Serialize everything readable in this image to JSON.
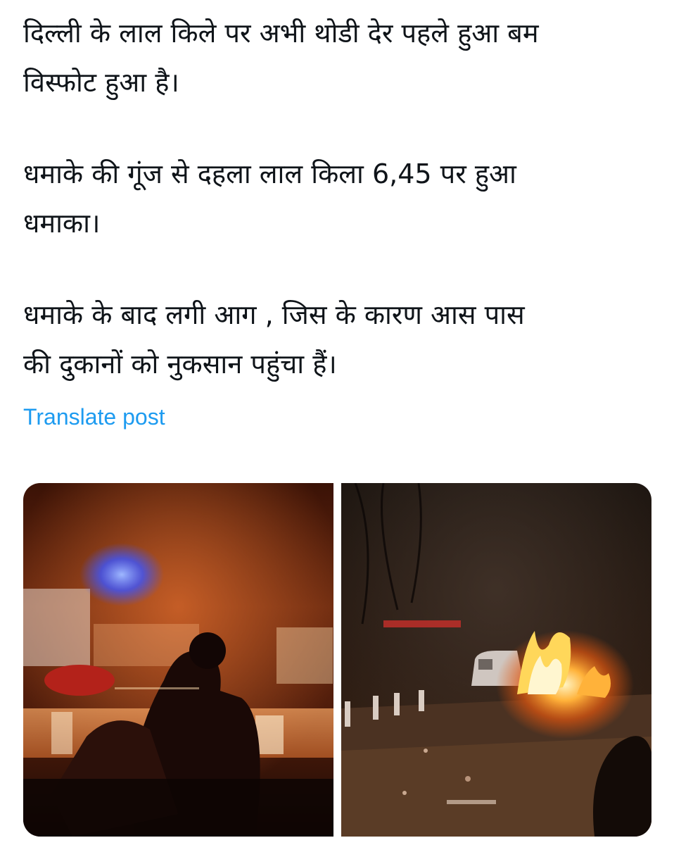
{
  "post": {
    "paragraphs": [
      {
        "lines": [
          "दिल्ली के लाल किले पर अभी थोडी देर पहले हुआ बम",
          "विस्फोट हुआ है।"
        ]
      },
      {
        "lines": [
          "धमाके की गूंज से दहला लाल किला 6,45 पर हुआ",
          "धमाका।"
        ]
      },
      {
        "lines": [
          "धमाके के बाद लगी आग , जिस के कारण आस पास",
          "की दुकानों को नुकसान पहुंचा हैं।"
        ]
      }
    ],
    "translate_label": "Translate post"
  },
  "media": [
    {
      "type": "photo",
      "subject": "night-crowd-fire-glow"
    },
    {
      "type": "photo",
      "subject": "burning-vehicle-street"
    }
  ],
  "colors": {
    "text": "#0f1419",
    "link": "#1d9bf0",
    "background": "#ffffff"
  }
}
